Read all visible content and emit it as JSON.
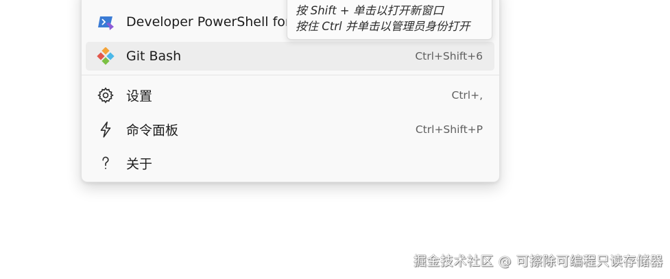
{
  "menu": {
    "items": [
      {
        "label": "Developer PowerShell for",
        "shortcut": "",
        "icon": "developer-powershell-icon"
      },
      {
        "label": "Git Bash",
        "shortcut": "Ctrl+Shift+6",
        "icon": "git-bash-icon"
      },
      {
        "label": "设置",
        "shortcut": "Ctrl+,",
        "icon": "gear-icon"
      },
      {
        "label": "命令面板",
        "shortcut": "Ctrl+Shift+P",
        "icon": "lightning-icon"
      },
      {
        "label": "关于",
        "shortcut": "",
        "icon": "question-mark-icon"
      }
    ],
    "hovered_item": "Git Bash"
  },
  "tooltip": {
    "line1": "按 Shift + 单击以打开新窗口",
    "line2": "按住 Ctrl 并单击以管理员身份打开"
  },
  "watermark": {
    "text": "掘金技术社区 @ 可擦除可编程只读存储器"
  },
  "colors": {
    "menu_background": "#f9f9f9",
    "hover_background": "#ededed",
    "powershell_icon_blue": "#3a7bd5",
    "powershell_icon_purple": "#8e5bd6"
  }
}
